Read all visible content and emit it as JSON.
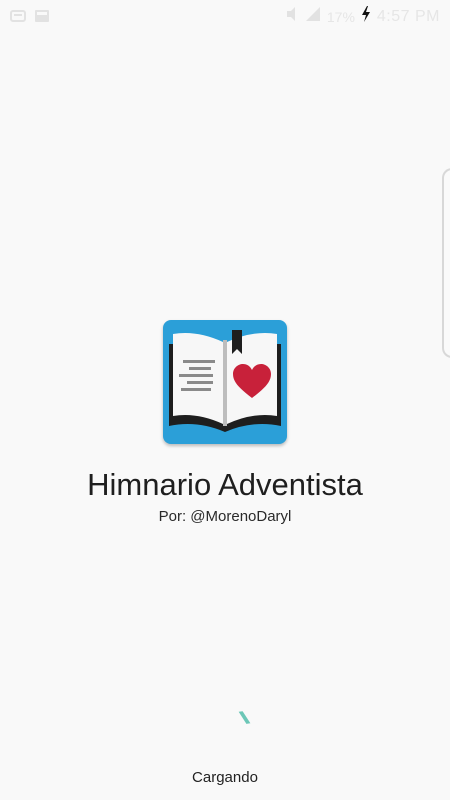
{
  "status_bar": {
    "time": "4:57 PM",
    "battery_text": "17%",
    "left_icons": [
      "notification-icon",
      "gallery-icon"
    ],
    "right_icons": [
      "mute-icon",
      "signal-icon",
      "charging-icon"
    ]
  },
  "app": {
    "title": "Himnario Adventista",
    "author": "Por: @MorenoDaryl",
    "icon": "open-book-heart-icon",
    "accent_color": "#2b9fd8",
    "heart_color": "#c8213a"
  },
  "loading": {
    "label": "Cargando",
    "spinner_color": "#6cc7b7"
  }
}
